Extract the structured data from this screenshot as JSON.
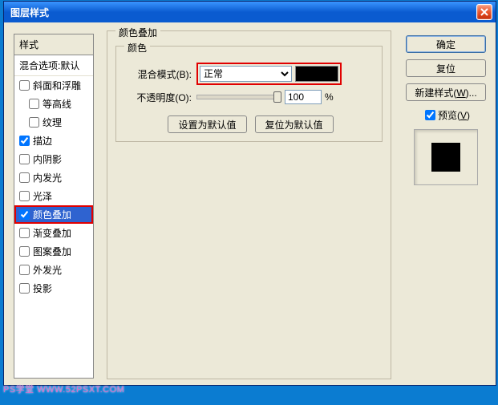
{
  "window": {
    "title": "图层样式"
  },
  "sidebar": {
    "header": "样式",
    "sub": "混合选项:默认",
    "items": [
      {
        "label": "斜面和浮雕",
        "checked": false
      },
      {
        "label": "等高线",
        "checked": false,
        "indent": true
      },
      {
        "label": "纹理",
        "checked": false,
        "indent": true
      },
      {
        "label": "描边",
        "checked": true
      },
      {
        "label": "内阴影",
        "checked": false
      },
      {
        "label": "内发光",
        "checked": false
      },
      {
        "label": "光泽",
        "checked": false
      },
      {
        "label": "颜色叠加",
        "checked": true,
        "selected": true,
        "highlight": true
      },
      {
        "label": "渐变叠加",
        "checked": false
      },
      {
        "label": "图案叠加",
        "checked": false
      },
      {
        "label": "外发光",
        "checked": false
      },
      {
        "label": "投影",
        "checked": false
      }
    ]
  },
  "main": {
    "group_title": "颜色叠加",
    "inner_title": "颜色",
    "blend_label": "混合模式(B):",
    "blend_value": "正常",
    "color_swatch": "#000000",
    "opacity_label": "不透明度(O):",
    "opacity_value": "100",
    "opacity_suffix": "%",
    "btn_default": "设置为默认值",
    "btn_reset": "复位为默认值"
  },
  "right": {
    "ok": "确定",
    "cancel": "复位",
    "new_style": "新建样式(W)...",
    "preview_label": "预览(V)",
    "preview_checked": true,
    "preview_color": "#000000"
  },
  "watermark": "PS学堂  WWW.52PSXT.COM"
}
